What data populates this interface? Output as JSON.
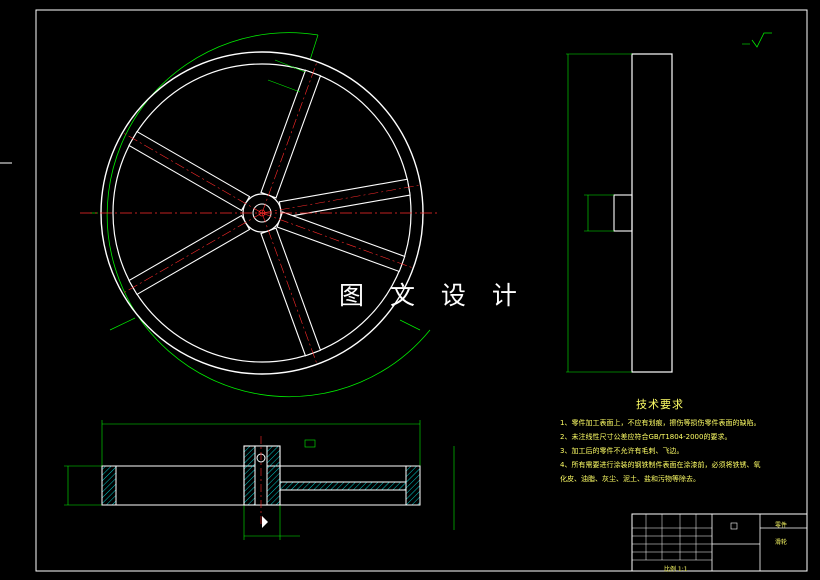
{
  "watermark": "图 文 设 计",
  "technical_requirements": {
    "title": "技术要求",
    "notes": [
      "1、零件加工表面上，不应有划痕，擦伤等损伤零件表面的缺陷。",
      "2、未注线性尺寸公差应符合GB/T1804-2000的要求。",
      "3、加工后的零件不允许有毛刺、飞边。",
      "4、所有需要进行涂装的钢铁制件表面在涂漆前，必须将铁锈、氧",
      "化皮、油脂、灰尘、泥土、盐和污物等除去。"
    ]
  },
  "title_block": {
    "part_name": "滑轮",
    "label": "零件",
    "ratio": "比例 1:1"
  },
  "colors": {
    "background": "#000000",
    "outline": "#ffffff",
    "centerline": "#ff2a2a",
    "dimension": "#00ee00",
    "hatch": "#00ffff",
    "text": "#ffff66"
  }
}
